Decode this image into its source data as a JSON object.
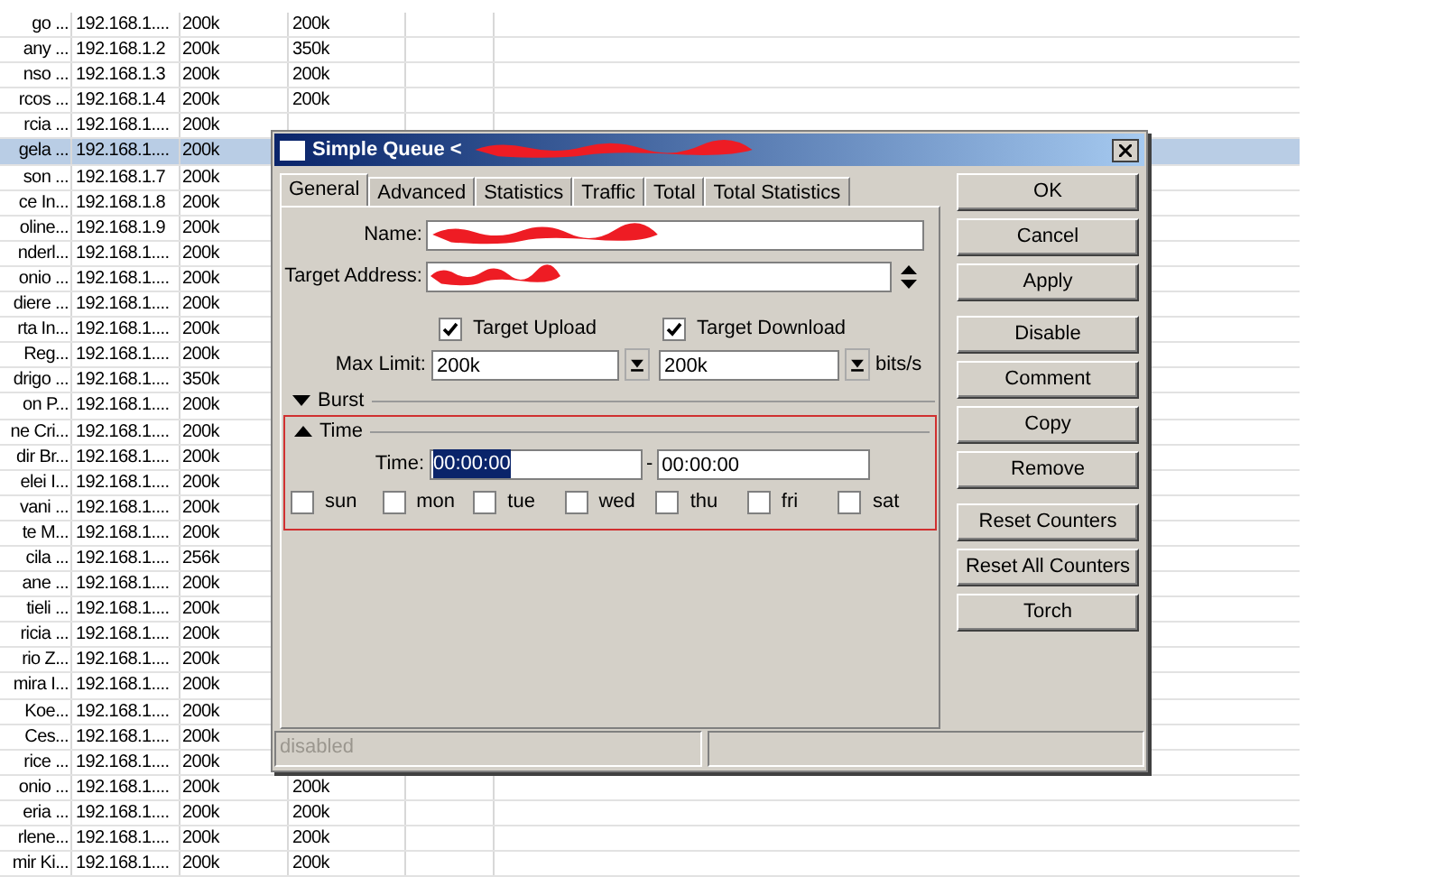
{
  "table": {
    "rows": [
      {
        "column_1": "go ...",
        "column_2": "192.168.1....",
        "column_3": "200k",
        "column_4": "200k",
        "selected": false
      },
      {
        "column_1": "any ...",
        "column_2": "192.168.1.2",
        "column_3": "200k",
        "column_4": "350k",
        "selected": false
      },
      {
        "column_1": "nso ...",
        "column_2": "192.168.1.3",
        "column_3": "200k",
        "column_4": "200k",
        "selected": false
      },
      {
        "column_1": "rcos ...",
        "column_2": "192.168.1.4",
        "column_3": "200k",
        "column_4": "200k",
        "selected": false
      },
      {
        "column_1": "rcia ...",
        "column_2": "192.168.1....",
        "column_3": "200k",
        "selected": false
      },
      {
        "column_1": "gela ...",
        "column_2": "192.168.1....",
        "column_3": "200k",
        "selected": true
      },
      {
        "column_1": "son ...",
        "column_2": "192.168.1.7",
        "column_3": "200k",
        "selected": false
      },
      {
        "column_1": "ce In...",
        "column_2": "192.168.1.8",
        "column_3": "200k",
        "selected": false
      },
      {
        "column_1": "oline...",
        "column_2": "192.168.1.9",
        "column_3": "200k",
        "selected": false
      },
      {
        "column_1": "nderl...",
        "column_2": "192.168.1....",
        "column_3": "200k",
        "selected": false
      },
      {
        "column_1": "onio ...",
        "column_2": "192.168.1....",
        "column_3": "200k",
        "selected": false
      },
      {
        "column_1": "diere ...",
        "column_2": "192.168.1....",
        "column_3": "200k",
        "selected": false
      },
      {
        "column_1": "rta In...",
        "column_2": "192.168.1....",
        "column_3": "200k",
        "selected": false
      },
      {
        "column_1": "Reg...",
        "column_2": "192.168.1....",
        "column_3": "200k",
        "selected": false
      },
      {
        "column_1": "drigo ...",
        "column_2": "192.168.1....",
        "column_3": "350k",
        "selected": false
      },
      {
        "column_1": "on P...",
        "column_2": "192.168.1....",
        "column_3": "200k",
        "selected": false
      },
      {
        "column_1": "ne Cri...",
        "column_2": "192.168.1....",
        "column_3": "200k",
        "selected": false
      },
      {
        "column_1": "dir Br...",
        "column_2": "192.168.1....",
        "column_3": "200k",
        "selected": false
      },
      {
        "column_1": "elei I...",
        "column_2": "192.168.1....",
        "column_3": "200k",
        "selected": false
      },
      {
        "column_1": "vani ...",
        "column_2": "192.168.1....",
        "column_3": "200k",
        "selected": false
      },
      {
        "column_1": "te M...",
        "column_2": "192.168.1....",
        "column_3": "200k",
        "selected": false
      },
      {
        "column_1": "cila ...",
        "column_2": "192.168.1....",
        "column_3": "256k",
        "selected": false
      },
      {
        "column_1": "ane ...",
        "column_2": "192.168.1....",
        "column_3": "200k",
        "selected": false
      },
      {
        "column_1": "tieli ...",
        "column_2": "192.168.1....",
        "column_3": "200k",
        "selected": false
      },
      {
        "column_1": "ricia ...",
        "column_2": "192.168.1....",
        "column_3": "200k",
        "selected": false
      },
      {
        "column_1": "rio Z...",
        "column_2": "192.168.1....",
        "column_3": "200k",
        "selected": false
      },
      {
        "column_1": "mira I...",
        "column_2": "192.168.1....",
        "column_3": "200k",
        "selected": false
      },
      {
        "column_1": "Koe...",
        "column_2": "192.168.1....",
        "column_3": "200k",
        "selected": false
      },
      {
        "column_1": "Ces...",
        "column_2": "192.168.1....",
        "column_3": "200k",
        "selected": false
      },
      {
        "column_1": "rice ...",
        "column_2": "192.168.1....",
        "column_3": "200k",
        "selected": false
      },
      {
        "column_1": "onio ...",
        "column_2": "192.168.1....",
        "column_3": "200k",
        "column_4": "200k",
        "selected": false
      },
      {
        "column_1": "eria ...",
        "column_2": "192.168.1....",
        "column_3": "200k",
        "column_4": "200k",
        "selected": false
      },
      {
        "column_1": "rlene...",
        "column_2": "192.168.1....",
        "column_3": "200k",
        "column_4": "200k",
        "selected": false
      },
      {
        "column_1": "mir Ki...",
        "column_2": "192.168.1....",
        "column_3": "200k",
        "column_4": "200k",
        "selected": false
      }
    ]
  },
  "dialog": {
    "title": "Simple Queue <",
    "title_redacted": true,
    "tabs": [
      {
        "label": "General",
        "selected": true
      },
      {
        "label": "Advanced",
        "selected": false
      },
      {
        "label": "Statistics",
        "selected": false
      },
      {
        "label": "Traffic",
        "selected": false
      },
      {
        "label": "Total",
        "selected": false
      },
      {
        "label": "Total Statistics",
        "selected": false
      }
    ],
    "name": {
      "label": "Name:",
      "redacted": true
    },
    "target_address": {
      "label": "Target Address:",
      "redacted": true
    },
    "target_upload": {
      "label": "Target Upload",
      "checked": true
    },
    "target_download": {
      "label": "Target Download",
      "checked": true
    },
    "max_limit": {
      "label": "Max Limit:",
      "upload": "200k",
      "download": "200k",
      "unit": "bits/s"
    },
    "burst": {
      "label": "Burst",
      "expanded": false
    },
    "time_section": {
      "label": "Time",
      "expanded": true,
      "highlighted": true,
      "time_label": "Time:",
      "from": "00:00:00",
      "separator": "-",
      "to": "00:00:00",
      "days": [
        {
          "label": "sun",
          "checked": false
        },
        {
          "label": "mon",
          "checked": false
        },
        {
          "label": "tue",
          "checked": false
        },
        {
          "label": "wed",
          "checked": false
        },
        {
          "label": "thu",
          "checked": false
        },
        {
          "label": "fri",
          "checked": false
        },
        {
          "label": "sat",
          "checked": false
        }
      ]
    },
    "button_groups": [
      {
        "buttons": [
          "OK",
          "Cancel",
          "Apply"
        ]
      },
      {
        "buttons": [
          "Disable",
          "Comment",
          "Copy",
          "Remove"
        ]
      },
      {
        "buttons": [
          "Reset Counters",
          "Reset All Counters",
          "Torch"
        ]
      }
    ],
    "status": "disabled"
  }
}
